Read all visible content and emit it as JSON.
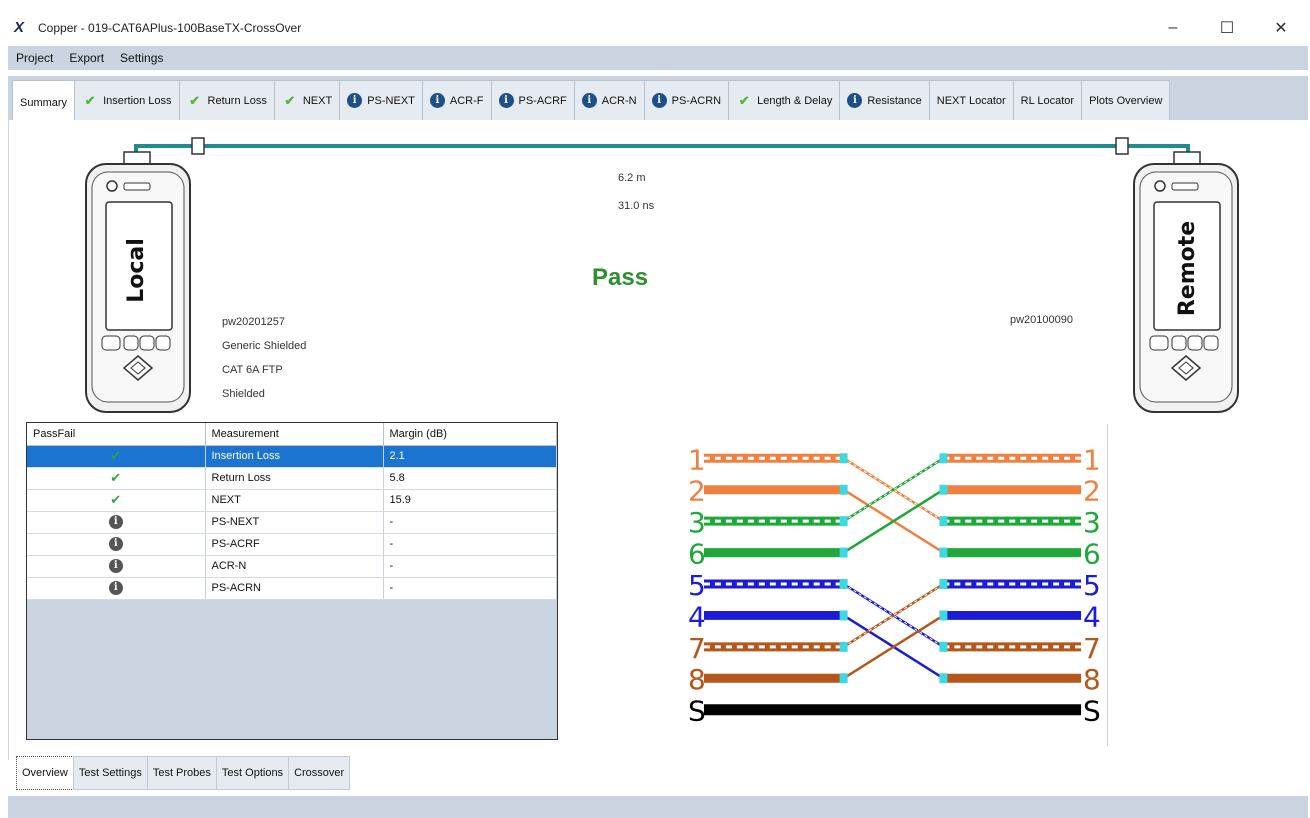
{
  "window": {
    "title": "Copper - 019-CAT6APlus-100BaseTX-CrossOver",
    "controls": [
      "minimize",
      "maximize",
      "close"
    ]
  },
  "menu": {
    "items": [
      "Project",
      "Export",
      "Settings"
    ]
  },
  "tabs": [
    {
      "label": "Summary",
      "icon": "none",
      "active": true
    },
    {
      "label": "Insertion Loss",
      "icon": "check"
    },
    {
      "label": "Return Loss",
      "icon": "check"
    },
    {
      "label": "NEXT",
      "icon": "check"
    },
    {
      "label": "PS-NEXT",
      "icon": "info"
    },
    {
      "label": "ACR-F",
      "icon": "info"
    },
    {
      "label": "PS-ACRF",
      "icon": "info"
    },
    {
      "label": "ACR-N",
      "icon": "info"
    },
    {
      "label": "PS-ACRN",
      "icon": "info"
    },
    {
      "label": "Length & Delay",
      "icon": "check"
    },
    {
      "label": "Resistance",
      "icon": "info"
    },
    {
      "label": "NEXT Locator",
      "icon": "none"
    },
    {
      "label": "RL Locator",
      "icon": "none"
    },
    {
      "label": "Plots Overview",
      "icon": "none"
    }
  ],
  "summary": {
    "length": "6.2 m",
    "delay": "31.0 ns",
    "result": "Pass",
    "local_label": "Local",
    "remote_label": "Remote",
    "local_id": "pw20201257",
    "remote_id": "pw20100090",
    "details": [
      "Generic Shielded",
      "CAT 6A FTP",
      "Shielded"
    ]
  },
  "results_table": {
    "headers": [
      "PassFail",
      "Measurement",
      "Margin (dB)"
    ],
    "rows": [
      {
        "status": "pass",
        "measurement": "Insertion Loss",
        "margin": "2.1",
        "selected": true
      },
      {
        "status": "pass",
        "measurement": "Return Loss",
        "margin": "5.8"
      },
      {
        "status": "pass",
        "measurement": "NEXT",
        "margin": "15.9"
      },
      {
        "status": "info",
        "measurement": "PS-NEXT",
        "margin": "-"
      },
      {
        "status": "info",
        "measurement": "PS-ACRF",
        "margin": "-"
      },
      {
        "status": "info",
        "measurement": "ACR-N",
        "margin": "-"
      },
      {
        "status": "info",
        "measurement": "PS-ACRN",
        "margin": "-"
      }
    ]
  },
  "wiremap": {
    "left_pins": [
      "1",
      "2",
      "3",
      "6",
      "5",
      "4",
      "7",
      "8",
      "S"
    ],
    "right_pins": [
      "1",
      "2",
      "3",
      "6",
      "5",
      "4",
      "7",
      "8",
      "S"
    ],
    "colors": {
      "orange": "#f08040",
      "green": "#1fa83a",
      "blue": "#1c1cd6",
      "brown": "#b5561a",
      "shield": "#000000",
      "end": "#40d8e0"
    }
  },
  "bottom_tabs": [
    "Overview",
    "Test Settings",
    "Test Probes",
    "Test Options",
    "Crossover"
  ]
}
